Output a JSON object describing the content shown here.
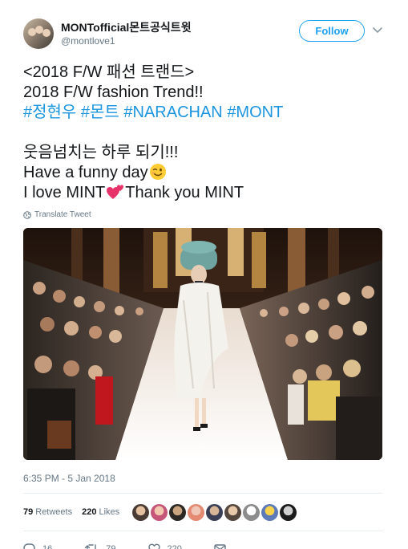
{
  "user": {
    "display_name": "MONTofficial몬트공식트윗",
    "screen_name": "@montlove1",
    "follow_label": "Follow",
    "avatar_icon": "user-avatar-photo"
  },
  "tweet": {
    "line1": "<2018 F/W 패션 트랜드>",
    "line2": "2018 F/W fashion Trend!!",
    "hashtags": [
      "#정현우",
      "#몬트",
      "#NARACHAN",
      "#MONT"
    ],
    "line4": "웃음넘치는 하루 되기!!!",
    "line5": "Have a funny day",
    "line6_pre": "I love MINT",
    "line6_post": "Thank you MINT",
    "emoji_wink": "winking-face-emoji",
    "emoji_hearts": "two-hearts-emoji"
  },
  "translate_label": "Translate Tweet",
  "media": {
    "icon": "runway-fashion-photo"
  },
  "timestamp": "6:35 PM - 5 Jan 2018",
  "stats": {
    "retweets_count": "79",
    "retweets_label": "Retweets",
    "likes_count": "220",
    "likes_label": "Likes"
  },
  "actions": {
    "reply_count": "16",
    "retweet_count": "79",
    "like_count": "220"
  },
  "colors": {
    "accent": "#1da1f2",
    "hashtag": "#1b95e0",
    "muted": "#657786",
    "text": "#14171a",
    "divider": "#e6ecf0"
  }
}
